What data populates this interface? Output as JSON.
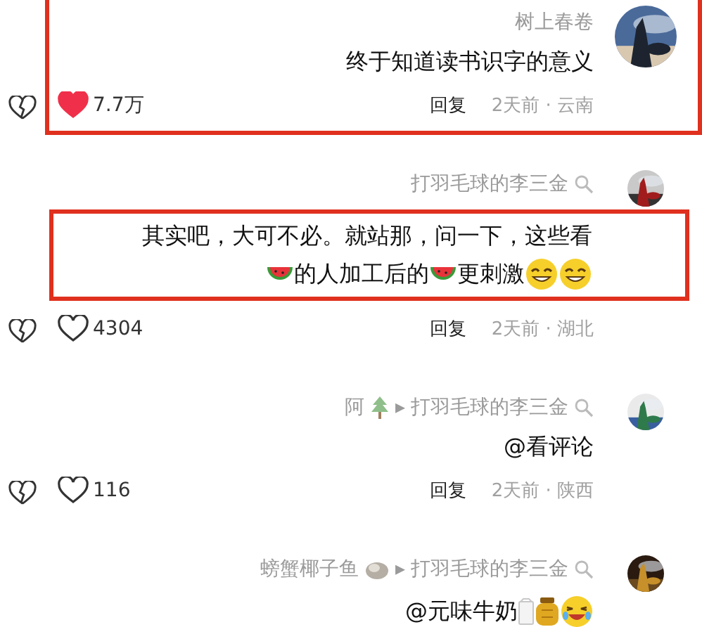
{
  "comments": [
    {
      "author": [
        {
          "kind": "text",
          "text": "树上春卷"
        }
      ],
      "search_mark": false,
      "highlighted": true,
      "text_highlighted": false,
      "content": [
        [
          {
            "kind": "text",
            "text": "终于知道读书识字的意义"
          }
        ]
      ],
      "meta": "2天前 · 云南",
      "reply": "回复",
      "likes": "7.7万",
      "liked": true
    },
    {
      "author": [
        {
          "kind": "text",
          "text": "打羽毛球的李三金"
        }
      ],
      "search_mark": true,
      "highlighted": false,
      "text_highlighted": true,
      "content": [
        [
          {
            "kind": "text",
            "text": "其实吧，大可不必。就站那，问一下，这些看"
          }
        ],
        [
          {
            "kind": "watermelon"
          },
          {
            "kind": "text",
            "text": "的人加工后的"
          },
          {
            "kind": "watermelon"
          },
          {
            "kind": "text",
            "text": "更刺激"
          },
          {
            "kind": "grin"
          },
          {
            "kind": "grin"
          }
        ]
      ],
      "meta": "2天前 · 湖北",
      "reply": "回复",
      "likes": "4304",
      "liked": false
    },
    {
      "author": [
        {
          "kind": "text",
          "text": "阿"
        },
        {
          "kind": "tree"
        }
      ],
      "arrow": "▸",
      "reply_to": "打羽毛球的李三金",
      "search_mark": true,
      "highlighted": false,
      "text_highlighted": false,
      "content": [
        [
          {
            "kind": "text",
            "text": "@看评论"
          }
        ]
      ],
      "meta": "2天前 · 陕西",
      "reply": "回复",
      "likes": "116",
      "liked": false
    },
    {
      "author": [
        {
          "kind": "text",
          "text": "螃蟹椰子鱼"
        },
        {
          "kind": "bun"
        }
      ],
      "arrow": "▸",
      "reply_to": "打羽毛球的李三金",
      "search_mark": true,
      "highlighted": false,
      "text_highlighted": false,
      "content": [
        [
          {
            "kind": "text",
            "text": "@元味牛奶"
          },
          {
            "kind": "milk"
          },
          {
            "kind": "honey"
          },
          {
            "kind": "laugh"
          }
        ]
      ]
    }
  ]
}
